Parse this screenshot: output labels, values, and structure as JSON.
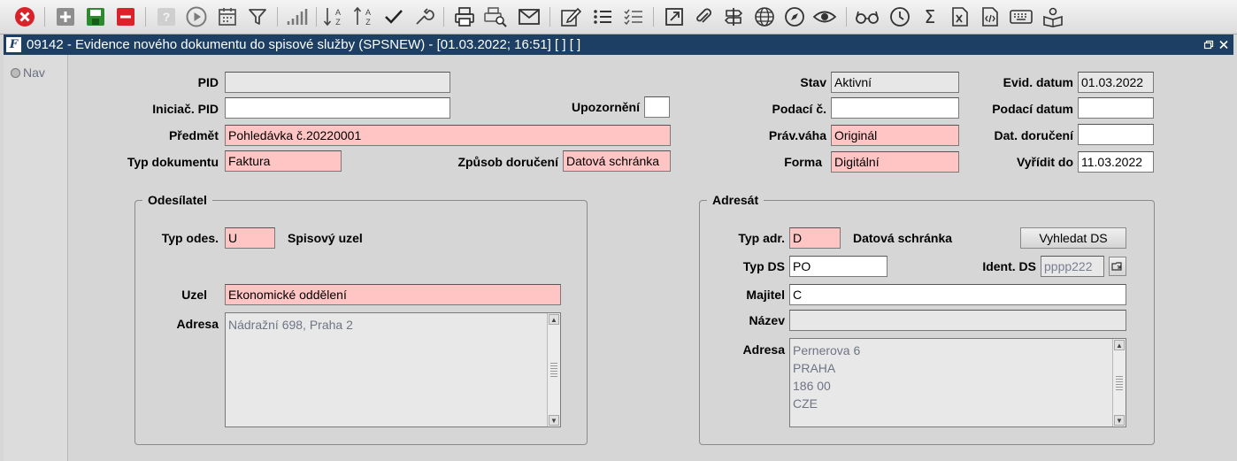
{
  "window": {
    "title": "09142 - Evidence nového dokumentu do spisové služby (SPSNEW) - [01.03.2022; 16:51]  [ ]  [ ]",
    "logo_text": "F"
  },
  "nav": {
    "label": "Nav"
  },
  "form": {
    "pid": {
      "label": "PID",
      "value": ""
    },
    "iniciac_pid": {
      "label": "Iniciač. PID",
      "value": ""
    },
    "upozorneni": {
      "label": "Upozornění",
      "value": ""
    },
    "predmet": {
      "label": "Předmět",
      "value": "Pohledávka č.20220001"
    },
    "typ_dokumentu": {
      "label": "Typ dokumentu",
      "value": "Faktura"
    },
    "zpusob_doruceni": {
      "label": "Způsob doručení",
      "value": "Datová schránka"
    },
    "stav": {
      "label": "Stav",
      "value": "Aktivní"
    },
    "podaci_c": {
      "label": "Podací č.",
      "value": ""
    },
    "prav_vaha": {
      "label": "Práv.váha",
      "value": "Originál"
    },
    "forma": {
      "label": "Forma",
      "value": "Digitální"
    },
    "evid_datum": {
      "label": "Evid. datum",
      "value": "01.03.2022"
    },
    "podaci_datum": {
      "label": "Podací datum",
      "value": ""
    },
    "dat_doruceni": {
      "label": "Dat. doručení",
      "value": ""
    },
    "vyridit_do": {
      "label": "Vyřídit do",
      "value": "11.03.2022"
    }
  },
  "odesilatel": {
    "title": "Odesílatel",
    "typ_odes": {
      "label": "Typ odes.",
      "value": "U",
      "desc": "Spisový uzel"
    },
    "uzel": {
      "label": "Uzel",
      "value": "Ekonomické oddělení"
    },
    "adresa": {
      "label": "Adresa",
      "lines": [
        "Nádražní 698, Praha 2"
      ]
    }
  },
  "adresat": {
    "title": "Adresát",
    "typ_adr": {
      "label": "Typ adr.",
      "value": "D",
      "desc": "Datová schránka"
    },
    "vyhledat_ds": "Vyhledat DS",
    "typ_ds": {
      "label": "Typ DS",
      "value": "PO"
    },
    "ident_ds": {
      "label": "Ident. DS",
      "value": "pppp222"
    },
    "majitel": {
      "label": "Majitel",
      "value": "C"
    },
    "nazev": {
      "label": "Název",
      "value": ""
    },
    "adresa": {
      "label": "Adresa",
      "lines": [
        "Pernerova 6",
        "PRAHA",
        "186 00",
        "CZE"
      ]
    }
  }
}
